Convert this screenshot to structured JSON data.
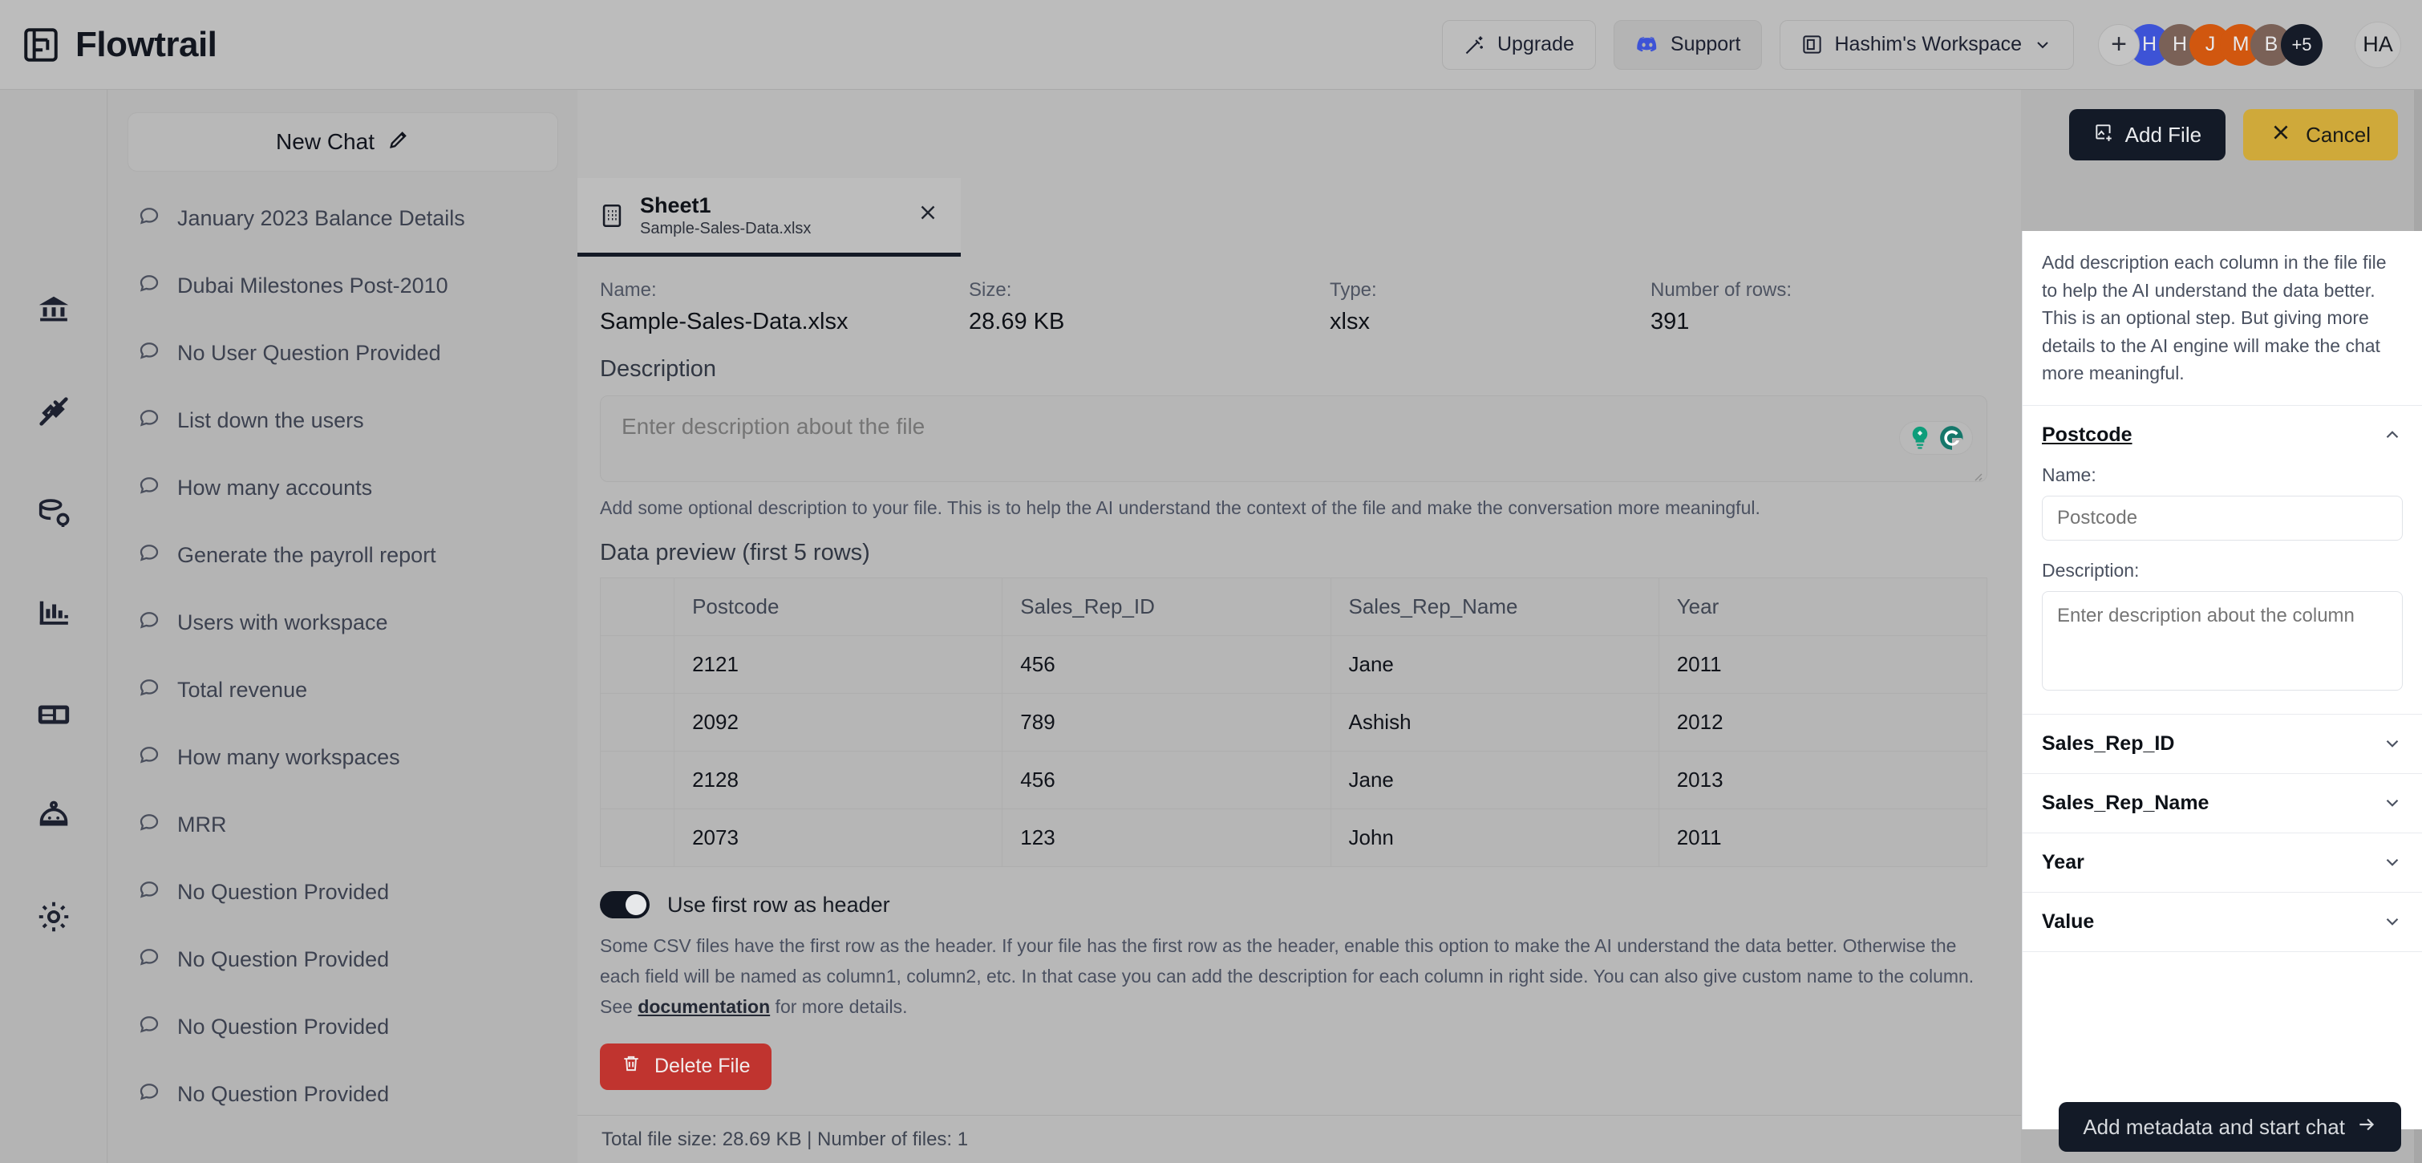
{
  "header": {
    "brand": "Flowtrail",
    "brand_logo_icon": "flowtrail-logo-icon",
    "upgrade_label": "Upgrade",
    "upgrade_icon": "sparkle-wand-icon",
    "support_label": "Support",
    "support_icon": "discord-icon",
    "workspace_label": "Hashim's Workspace",
    "workspace_icon": "workspace-box-icon",
    "workspace_chevron": "chevron-down-icon",
    "avatar_add": "+",
    "avatars": [
      {
        "initial": "H",
        "color": "#3d53d6"
      },
      {
        "initial": "H",
        "color": "#7a6157"
      },
      {
        "initial": "J",
        "color": "#d1570f"
      },
      {
        "initial": "M",
        "color": "#d1570f"
      },
      {
        "initial": "B",
        "color": "#7a6157"
      },
      {
        "initial": "+5",
        "color": "#151b28"
      }
    ],
    "user_avatar": "HA"
  },
  "rail": {
    "items": [
      {
        "name": "home-icon",
        "label": "Home"
      },
      {
        "name": "plug-connection-icon",
        "label": "Connections"
      },
      {
        "name": "database-settings-icon",
        "label": "Data sources"
      },
      {
        "name": "bar-chart-icon",
        "label": "Charts"
      },
      {
        "name": "dashboard-card-icon",
        "label": "Dashboards"
      },
      {
        "name": "robot-icon",
        "label": "AI Agent"
      },
      {
        "name": "gear-icon",
        "label": "Settings"
      }
    ]
  },
  "sidebar": {
    "new_chat_label": "New Chat",
    "new_chat_icon": "pencil-icon",
    "chats": [
      "January 2023 Balance Details",
      "Dubai Milestones Post-2010",
      "No User Question Provided",
      "List down the users",
      "How many accounts",
      "Generate the payroll report",
      "Users with workspace",
      "Total revenue",
      "How many workspaces",
      "MRR",
      "No Question Provided",
      "No Question Provided",
      "No Question Provided",
      "No Question Provided"
    ]
  },
  "modal": {
    "add_file_label": "Add File",
    "add_file_icon": "image-plus-icon",
    "cancel_label": "Cancel",
    "cancel_icon": "close-x-icon",
    "tab": {
      "title": "Sheet1",
      "subtitle": "Sample-Sales-Data.xlsx",
      "icon": "spreadsheet-icon",
      "close_icon": "close-x-icon"
    },
    "meta": [
      {
        "label": "Name:",
        "value": "Sample-Sales-Data.xlsx"
      },
      {
        "label": "Size:",
        "value": "28.69 KB"
      },
      {
        "label": "Type:",
        "value": "xlsx"
      },
      {
        "label": "Number of rows:",
        "value": "391"
      }
    ],
    "description_section_title": "Description",
    "description_placeholder": "Enter description about the file",
    "description_value": "",
    "description_hint": "Add some optional description to your file. This is to help the AI understand the context of the file and make the conversation more meaningful.",
    "grammarly_icons": [
      "grammarly-bulb-icon",
      "grammarly-g-icon"
    ],
    "preview_title": "Data preview (first 5 rows)",
    "table": {
      "columns": [
        "",
        "Postcode",
        "Sales_Rep_ID",
        "Sales_Rep_Name",
        "Year"
      ],
      "rows": [
        [
          "",
          "2121",
          "456",
          "Jane",
          "2011"
        ],
        [
          "",
          "2092",
          "789",
          "Ashish",
          "2012"
        ],
        [
          "",
          "2128",
          "456",
          "Jane",
          "2013"
        ],
        [
          "",
          "2073",
          "123",
          "John",
          "2011"
        ]
      ]
    },
    "toggle": {
      "label": "Use first row as header",
      "state": "on"
    },
    "toggle_help_1": "Some CSV files have the first row as the header. If your file has the first row as the header, enable this option to make the AI understand the data better. Otherwise the each field will be named as column1, column2, etc. In that case you can add the description for each column in right side. You can also give custom name to the column. See ",
    "toggle_help_link": "documentation",
    "toggle_help_2": " for more details.",
    "delete_label": "Delete File",
    "delete_icon": "trash-icon",
    "footer_status": "Total file size: 28.69 KB | Number of files: 1"
  },
  "right_panel": {
    "intro": "Add description each column in the file file to help the AI understand the data better. This is an optional step. But giving more details to the AI engine will make the chat more meaningful.",
    "columns": [
      {
        "name": "Postcode",
        "open": true,
        "name_label": "Name:",
        "name_placeholder": "Postcode",
        "name_value": "",
        "desc_label": "Description:",
        "desc_placeholder": "Enter description about the column",
        "desc_value": "",
        "chevron": "chevron-up-icon"
      },
      {
        "name": "Sales_Rep_ID",
        "open": false,
        "chevron": "chevron-down-icon"
      },
      {
        "name": "Sales_Rep_Name",
        "open": false,
        "chevron": "chevron-down-icon"
      },
      {
        "name": "Year",
        "open": false,
        "chevron": "chevron-down-icon"
      },
      {
        "name": "Value",
        "open": false,
        "chevron": "chevron-down-icon"
      }
    ]
  },
  "cta": {
    "label": "Add metadata and start chat",
    "arrow_icon": "arrow-right-icon"
  },
  "colors": {
    "accent_dark": "#131a27",
    "amber": "#cfa93a",
    "danger": "#c0342f",
    "panel_bg": "#ffffff",
    "app_bg": "#b3b3b3"
  }
}
